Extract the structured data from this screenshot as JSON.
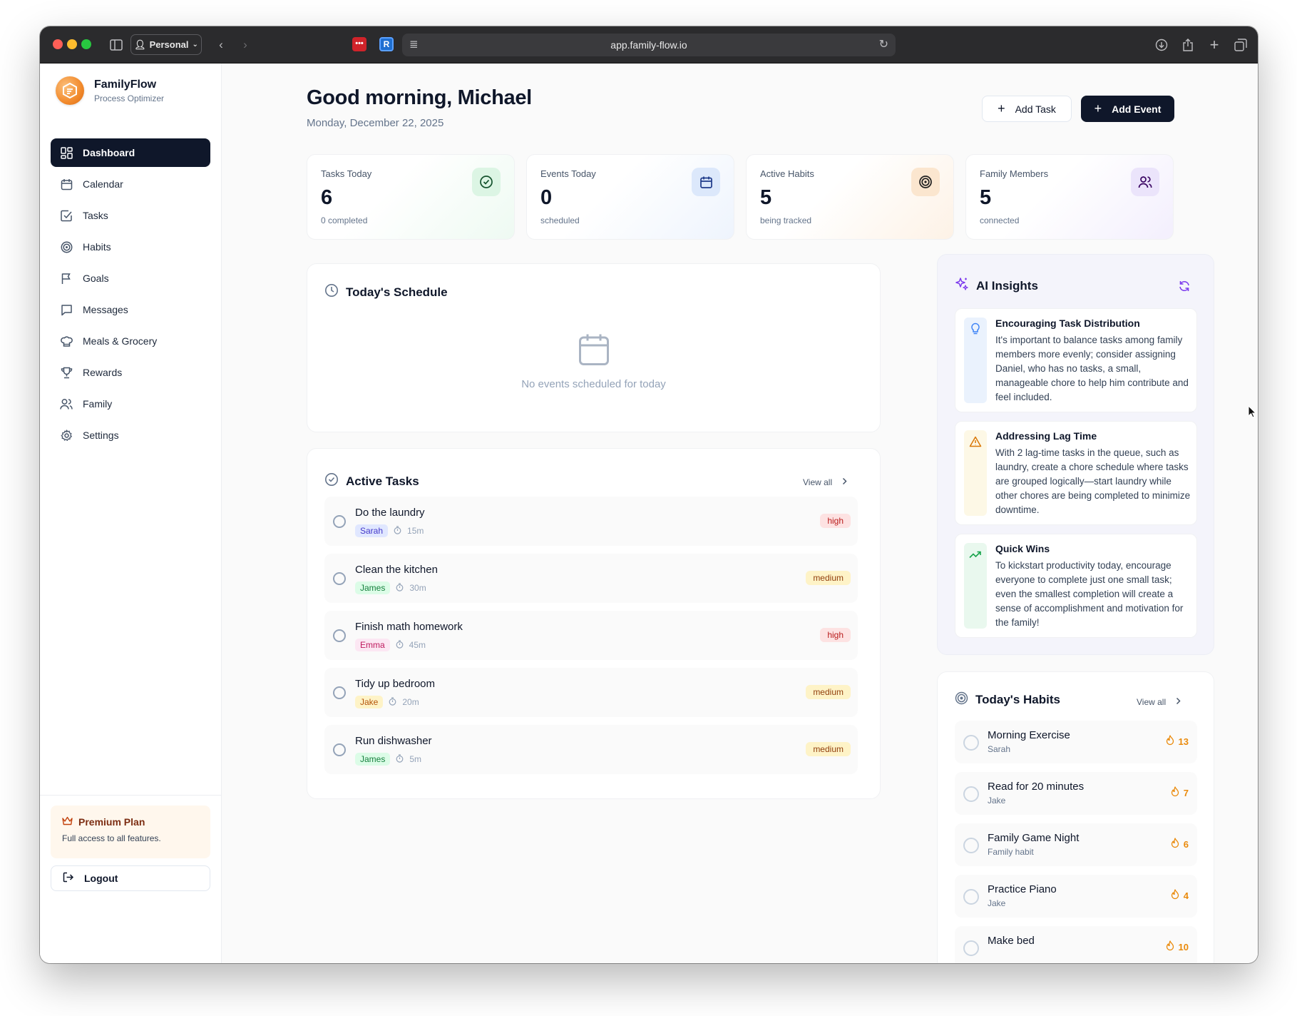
{
  "browser": {
    "profile": "Personal",
    "url": "app.family-flow.io"
  },
  "brand": {
    "name": "FamilyFlow",
    "subtitle": "Process Optimizer"
  },
  "nav": [
    {
      "label": "Dashboard",
      "icon": "dashboard-icon",
      "active": true
    },
    {
      "label": "Calendar",
      "icon": "calendar-icon"
    },
    {
      "label": "Tasks",
      "icon": "checkbox-icon"
    },
    {
      "label": "Habits",
      "icon": "target-icon"
    },
    {
      "label": "Goals",
      "icon": "flag-icon"
    },
    {
      "label": "Messages",
      "icon": "message-icon"
    },
    {
      "label": "Meals & Grocery",
      "icon": "chef-hat-icon"
    },
    {
      "label": "Rewards",
      "icon": "trophy-icon"
    },
    {
      "label": "Family",
      "icon": "users-icon"
    },
    {
      "label": "Settings",
      "icon": "gear-icon"
    }
  ],
  "premium": {
    "title": "Premium Plan",
    "subtitle": "Full access to all features."
  },
  "logout_label": "Logout",
  "header": {
    "greeting": "Good morning, Michael",
    "date": "Monday, December 22, 2025",
    "add_task_label": "Add Task",
    "add_event_label": "Add Event"
  },
  "stats": [
    {
      "label": "Tasks Today",
      "value": "6",
      "sub": "0 completed",
      "icon": "check-circle-icon",
      "accent": "#16a34a"
    },
    {
      "label": "Events Today",
      "value": "0",
      "sub": "scheduled",
      "icon": "calendar-icon",
      "accent": "#2563eb"
    },
    {
      "label": "Active Habits",
      "value": "5",
      "sub": "being tracked",
      "icon": "target-icon",
      "accent": "#ea580c"
    },
    {
      "label": "Family Members",
      "value": "5",
      "sub": "connected",
      "icon": "users-icon",
      "accent": "#7c3aed"
    }
  ],
  "schedule": {
    "title": "Today's Schedule",
    "empty_text": "No events scheduled for today"
  },
  "active_tasks": {
    "title": "Active Tasks",
    "view_all": "View all",
    "items": [
      {
        "title": "Do the laundry",
        "assignee": "Sarah",
        "duration": "15m",
        "priority": "high"
      },
      {
        "title": "Clean the kitchen",
        "assignee": "James",
        "duration": "30m",
        "priority": "medium"
      },
      {
        "title": "Finish math homework",
        "assignee": "Emma",
        "duration": "45m",
        "priority": "high"
      },
      {
        "title": "Tidy up bedroom",
        "assignee": "Jake",
        "duration": "20m",
        "priority": "medium"
      },
      {
        "title": "Run dishwasher",
        "assignee": "James",
        "duration": "5m",
        "priority": "medium"
      }
    ]
  },
  "assignee_colors": {
    "Sarah": {
      "bg": "#e0e7ff",
      "fg": "#4338ca"
    },
    "James": {
      "bg": "#dcfce7",
      "fg": "#15803d"
    },
    "Emma": {
      "bg": "#fce7f3",
      "fg": "#be185d"
    },
    "Jake": {
      "bg": "#fef3c7",
      "fg": "#b45309"
    }
  },
  "insights": {
    "title": "AI Insights",
    "items": [
      {
        "title": "Encouraging Task Distribution",
        "body": "It's important to balance tasks among family members more evenly; consider assigning Daniel, who has no tasks, a small, manageable chore to help him contribute and feel included.",
        "icon": "lightbulb-icon",
        "bar": "#eaf2fd",
        "color": "#3b82f6"
      },
      {
        "title": "Addressing Lag Time",
        "body": "With 2 lag-time tasks in the queue, such as laundry, create a chore schedule where tasks are grouped logically—start laundry while other chores are being completed to minimize downtime.",
        "icon": "warning-icon",
        "bar": "#fdf8e6",
        "color": "#d97706"
      },
      {
        "title": "Quick Wins",
        "body": "To kickstart productivity today, encourage everyone to complete just one small task; even the smallest completion will create a sense of accomplishment and motivation for the family!",
        "icon": "trending-up-icon",
        "bar": "#e9f8ee",
        "color": "#16a34a"
      }
    ]
  },
  "habits": {
    "title": "Today's Habits",
    "view_all": "View all",
    "items": [
      {
        "name": "Morning Exercise",
        "owner": "Sarah",
        "streak": "13"
      },
      {
        "name": "Read for 20 minutes",
        "owner": "Jake",
        "streak": "7"
      },
      {
        "name": "Family Game Night",
        "owner": "Family habit",
        "streak": "6"
      },
      {
        "name": "Practice Piano",
        "owner": "Jake",
        "streak": "4"
      },
      {
        "name": "Make bed",
        "owner": "",
        "streak": "10"
      }
    ]
  }
}
